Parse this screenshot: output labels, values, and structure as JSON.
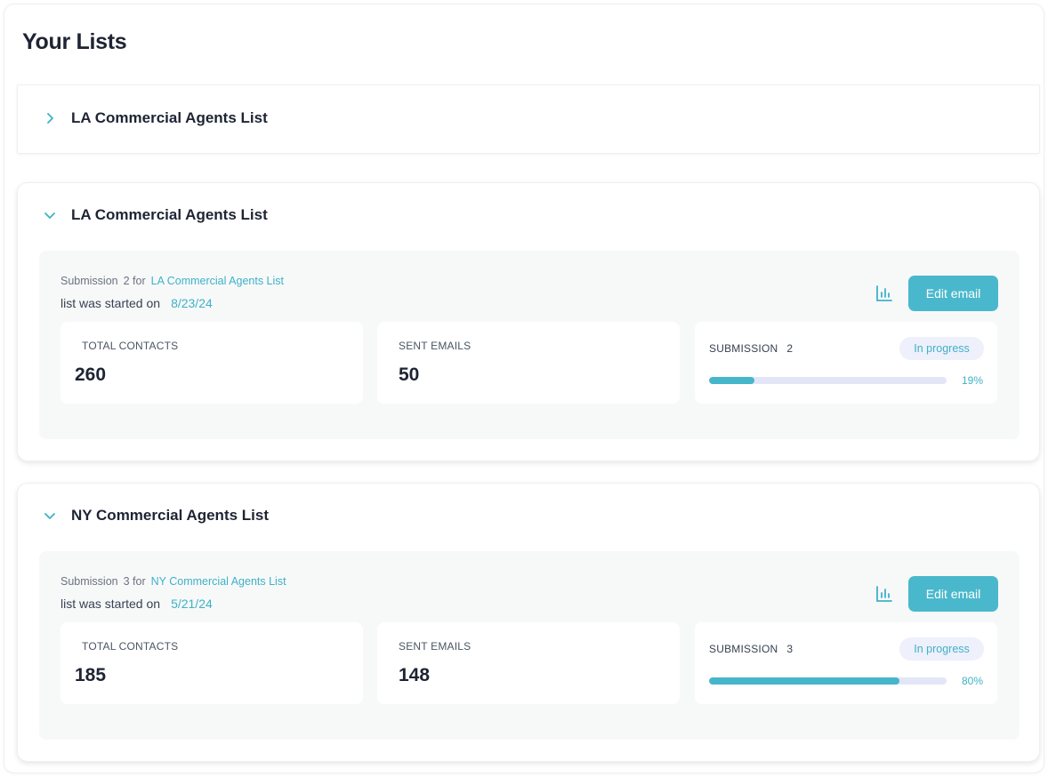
{
  "page": {
    "title": "Your Lists"
  },
  "colors": {
    "accent": "#4ab8cc",
    "link": "#3fb1c7",
    "track": "#e3e6f6",
    "badge_bg": "#eef0fb"
  },
  "collapsed_list": {
    "title": "LA Commercial Agents List",
    "icon": "chevron-right-icon"
  },
  "lists": [
    {
      "title": "LA Commercial Agents List",
      "icon": "chevron-down-icon",
      "submission_label": "Submission",
      "submission_number": "2 for",
      "submission_link": "LA Commercial Agents List",
      "started_label": "list was started on",
      "started_date": "8/23/24",
      "chart_icon": "bar-chart-icon",
      "edit_label": "Edit email",
      "total_contacts_label": "TOTAL CONTACTS",
      "total_contacts": "260",
      "sent_emails_label": "SENT EMAILS",
      "sent_emails": "50",
      "progress_label": "SUBMISSION",
      "progress_number": "2",
      "status": "In progress",
      "progress_percent": 19,
      "progress_text": "19%"
    },
    {
      "title": "NY Commercial Agents List",
      "icon": "chevron-down-icon",
      "submission_label": "Submission",
      "submission_number": "3 for",
      "submission_link": "NY Commercial Agents List",
      "started_label": "list was started on",
      "started_date": "5/21/24",
      "chart_icon": "bar-chart-icon",
      "edit_label": "Edit email",
      "total_contacts_label": "TOTAL CONTACTS",
      "total_contacts": "185",
      "sent_emails_label": "SENT EMAILS",
      "sent_emails": "148",
      "progress_label": "SUBMISSION",
      "progress_number": "3",
      "status": "In progress",
      "progress_percent": 80,
      "progress_text": "80%"
    }
  ]
}
